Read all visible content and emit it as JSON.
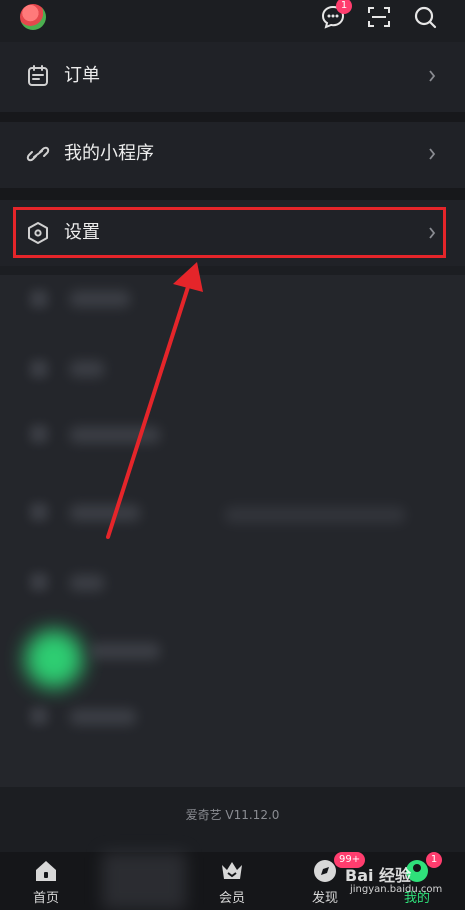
{
  "header": {
    "messages_badge": "1"
  },
  "menu": {
    "orders_label": "订单",
    "miniprogram_label": "我的小程序",
    "settings_label": "设置"
  },
  "footer": {
    "version": "爱奇艺 V11.12.0"
  },
  "tabs": {
    "home": "首页",
    "vip": "会员",
    "discover": "发现",
    "discover_badge": "99+",
    "me": "我的",
    "me_badge": "1"
  },
  "watermark": {
    "brand": "Bai 经验",
    "url": "jingyan.baidu.com"
  },
  "colors": {
    "accent": "#e5252a",
    "badge": "#ff3d6e",
    "active_tab": "#2fe07a"
  }
}
